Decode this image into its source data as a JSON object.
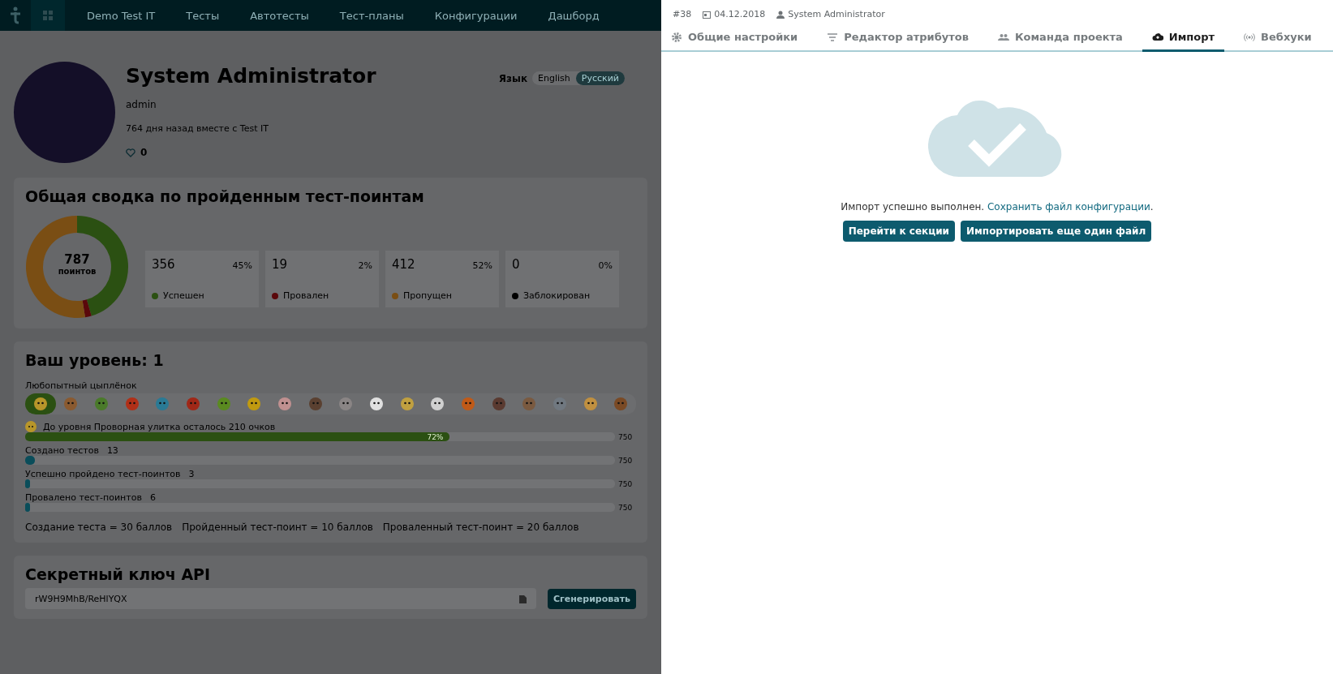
{
  "nav": {
    "items": [
      {
        "label": "Demo Test IT"
      },
      {
        "label": "Тесты"
      },
      {
        "label": "Автотесты"
      },
      {
        "label": "Тест-планы"
      },
      {
        "label": "Конфигурации"
      },
      {
        "label": "Дашборд"
      }
    ]
  },
  "profile": {
    "name": "System Administrator",
    "login": "admin",
    "since": "764 дня назад вместе с Test IT",
    "likes": "0",
    "language_label": "Язык",
    "languages": [
      {
        "label": "English",
        "selected": false
      },
      {
        "label": "Русский",
        "selected": true
      }
    ]
  },
  "summary": {
    "title": "Общая сводка по пройденным тест-поинтам",
    "total": "787",
    "total_label": "поинтов",
    "chart_data": {
      "type": "donut",
      "categories": [
        "Успешен",
        "Провален",
        "Пропущен",
        "Заблокирован"
      ],
      "series": [
        {
          "values": [
            45,
            2,
            52,
            0
          ]
        }
      ]
    },
    "cards": [
      {
        "count": "356",
        "percent": "45%",
        "color": "#2b5012"
      },
      {
        "count": "19",
        "percent": "2%",
        "color": "#5a080b"
      },
      {
        "count": "412",
        "percent": "52%",
        "color": "#7a4e14"
      },
      {
        "count": "0",
        "percent": "0%",
        "color": "#000000"
      }
    ]
  },
  "level": {
    "title": "Ваш уровень: 1",
    "rank": "Любопытный цыплёнок",
    "badges": [
      {
        "selected": true
      },
      {
        "selected": false
      },
      {
        "selected": false
      },
      {
        "selected": false
      },
      {
        "selected": false
      },
      {
        "selected": false
      },
      {
        "selected": false
      },
      {
        "selected": false
      },
      {
        "selected": false
      },
      {
        "selected": false
      },
      {
        "selected": false
      },
      {
        "selected": false
      },
      {
        "selected": false
      },
      {
        "selected": false
      },
      {
        "selected": false
      },
      {
        "selected": false
      },
      {
        "selected": false
      },
      {
        "selected": false
      },
      {
        "selected": false
      },
      {
        "selected": false
      }
    ],
    "progress": {
      "text": "До уровня Проворная улитка осталось 210 очков",
      "level": 0.72,
      "reading": "72%",
      "max": "750"
    },
    "stats": [
      {
        "label": "Создано тестов",
        "value": "13",
        "level": 0.017,
        "max": "750"
      },
      {
        "label": "Успешно пройдено тест-поинтов",
        "value": "3",
        "level": 0.004,
        "max": "750"
      },
      {
        "label": "Провалено тест-поинтов",
        "value": "6",
        "level": 0.008,
        "max": "750"
      }
    ],
    "rules": [
      "Создание теста = 30 баллов",
      "Пройденный тест-поинт = 10 баллов",
      "Проваленный тест-поинт = 20 баллов"
    ]
  },
  "api": {
    "title": "Секретный ключ API",
    "key": "rW9H9MhB/ReHlYQX",
    "button": "Сгенерировать"
  },
  "panel": {
    "id": "#38",
    "date": "04.12.2018",
    "user": "System Administrator",
    "tabs": [
      {
        "label": "Общие настройки",
        "kind": "settings",
        "selected": false
      },
      {
        "label": "Редактор атрибутов",
        "kind": "filter",
        "selected": false
      },
      {
        "label": "Команда проекта",
        "kind": "team",
        "selected": false
      },
      {
        "label": "Импорт",
        "kind": "cloud",
        "selected": true
      },
      {
        "label": "Вебхуки",
        "kind": "signal",
        "selected": false
      }
    ],
    "message": "Импорт успешно выполнен.",
    "link": "Сохранить файл конфигурации",
    "message_end": ".",
    "buttons": [
      "Перейти к секции",
      "Импортировать еще один файл"
    ]
  }
}
